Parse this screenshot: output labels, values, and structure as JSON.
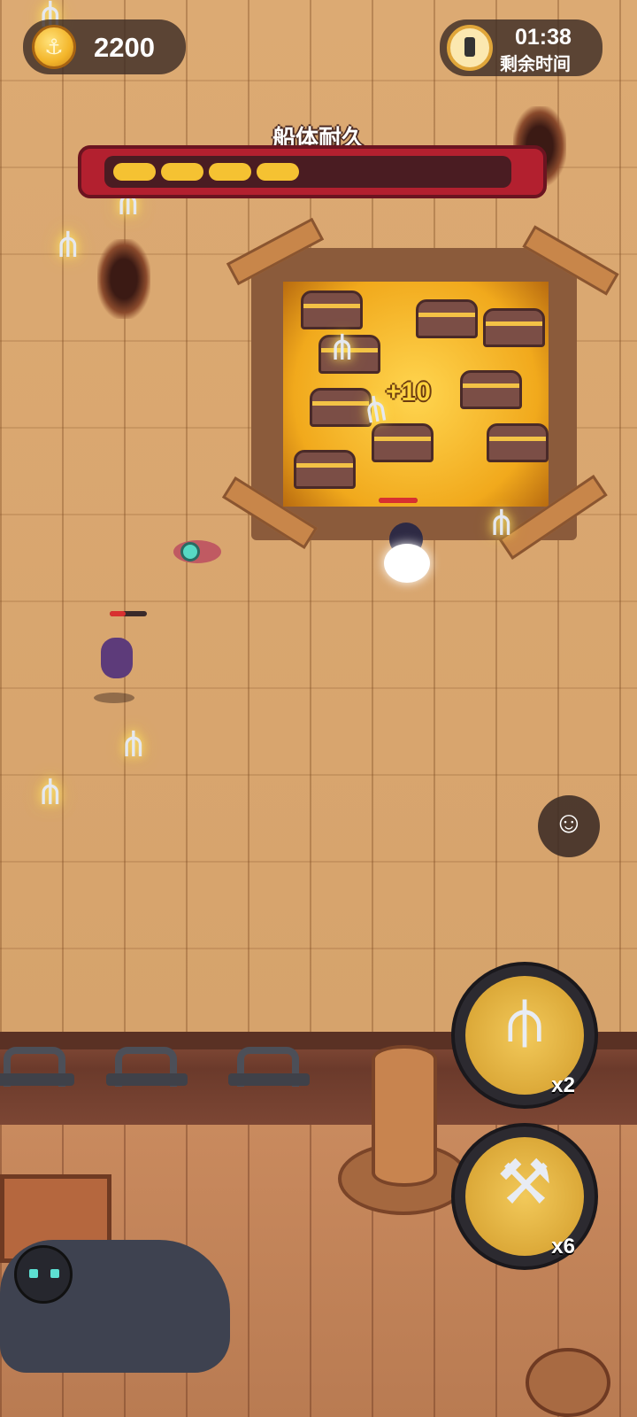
{
  "hud": {
    "coins": "2200",
    "coin_icon": "coin-icon",
    "timer": "01:38",
    "timer_label": "剩余时间",
    "timer_icon": "clock-icon"
  },
  "hull": {
    "title": "船体耐久",
    "segments_filled": 4,
    "bar_color": "#f5c232",
    "frame_color": "#b3202f"
  },
  "floating_text": "+10",
  "skills": [
    {
      "icon": "trident-icon",
      "glyph": "⫛",
      "count": "x2"
    },
    {
      "icon": "hammer-icon",
      "glyph": "⚒",
      "count": "x6"
    }
  ],
  "emote_icon": "smiley-speech-icon",
  "emote_glyph": "☺"
}
